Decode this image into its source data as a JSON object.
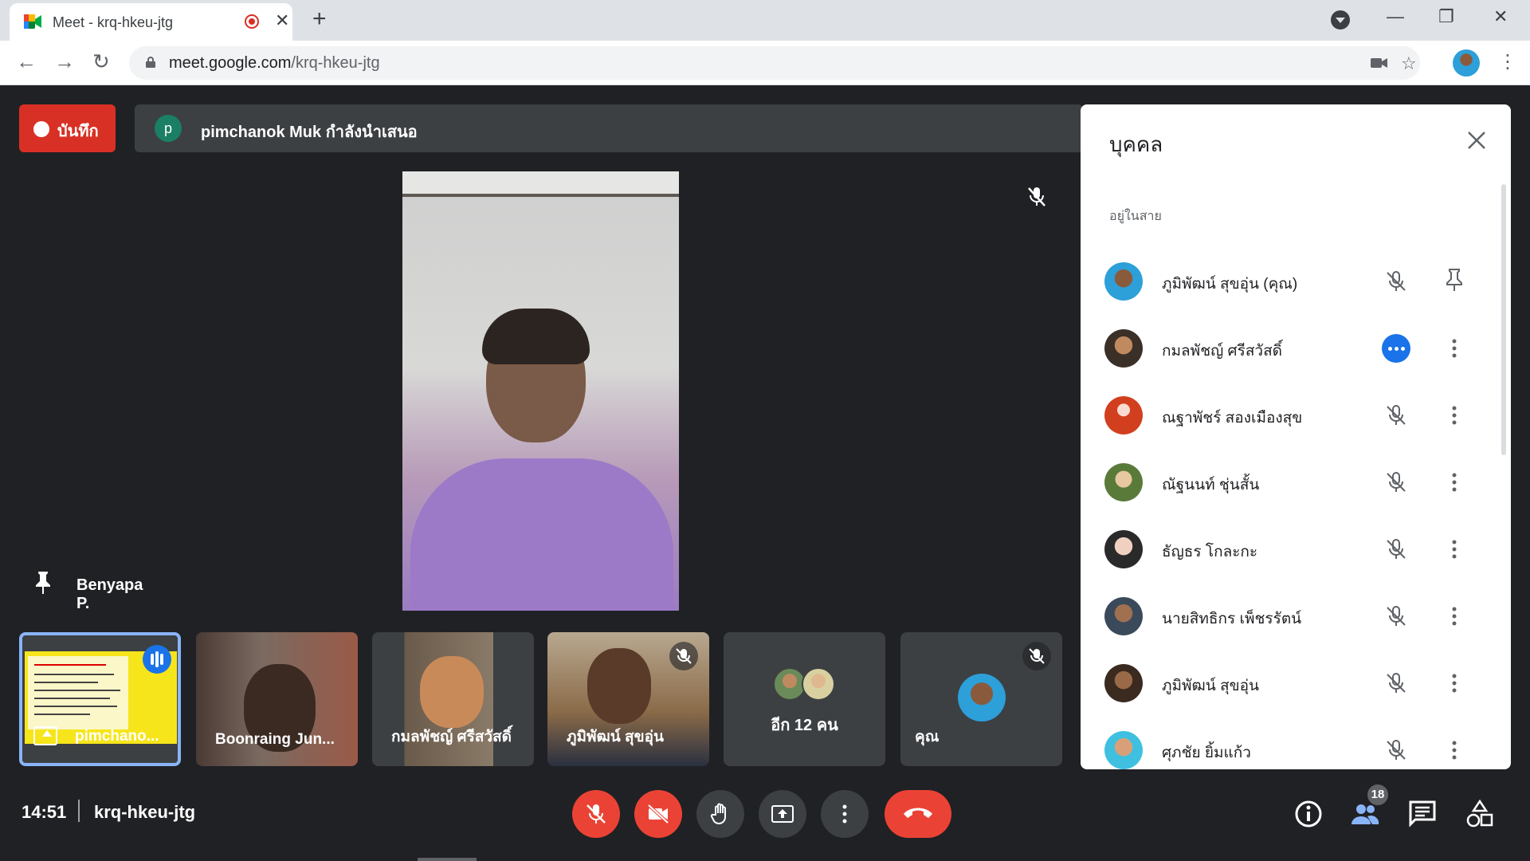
{
  "browser": {
    "tab_title": "Meet - krq-hkeu-jtg",
    "url_host": "meet.google.com",
    "url_path": "/krq-hkeu-jtg"
  },
  "meet": {
    "record_label": "บันทึก",
    "presenter_initial": "p",
    "presenting_text": "pimchanok Muk กำลังนำเสนอ",
    "pinned_name": "Benyapa P.",
    "tiles": [
      {
        "name": "pimchano..."
      },
      {
        "name": "Boonraing Jun..."
      },
      {
        "name": "กมลพัชญ์ ศรีสวัสดิ์"
      },
      {
        "name": "ภูมิพัฒน์ สุขอุ่น"
      },
      {
        "name": "อีก 12 คน"
      },
      {
        "name": "คุณ"
      }
    ],
    "clock": "14:51",
    "meeting_code": "krq-hkeu-jtg",
    "participant_count": "18"
  },
  "people_panel": {
    "title": "บุคคล",
    "section": "อยู่ในสาย",
    "participants": [
      {
        "name": "ภูมิพัฒน์ สุขอุ่น (คุณ)"
      },
      {
        "name": "กมลพัชญ์ ศรีสวัสดิ์"
      },
      {
        "name": "ณฐาพัชร์ สองเมืองสุข"
      },
      {
        "name": "ณัฐนนท์ ชุ่นสั้น"
      },
      {
        "name": "ธัญธร โกละกะ"
      },
      {
        "name": "นายสิทธิกร เพ็ชรรัตน์"
      },
      {
        "name": "ภูมิพัฒน์ สุขอุ่น"
      },
      {
        "name": "ศุภชัย ยิ้มแก้ว"
      }
    ]
  },
  "colors": {
    "accent": "#1a73e8",
    "danger": "#ea4335",
    "background": "#202124",
    "surface": "#3c4043"
  }
}
